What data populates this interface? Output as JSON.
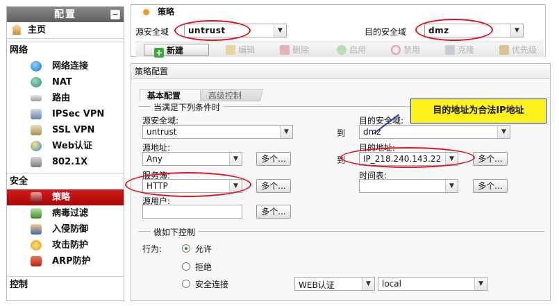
{
  "sidebar": {
    "title": "配置",
    "collapse_label": "−",
    "home": "主页",
    "sections": {
      "network": "网络",
      "security": "安全",
      "control": "控制"
    },
    "network_items": [
      "网络连接",
      "NAT",
      "路由",
      "IPSec VPN",
      "SSL VPN",
      "Web认证",
      "802.1X"
    ],
    "security_items": [
      "策略",
      "病毒过滤",
      "入侵防御",
      "攻击防护",
      "ARP防护"
    ],
    "active_item": "策略"
  },
  "policy_panel": {
    "title": "策略",
    "src_zone_label": "源安全域",
    "src_zone_value": "untrust",
    "dst_zone_label": "目的安全域",
    "dst_zone_value": "dmz",
    "toolbar": {
      "new": "新建",
      "edit": "编辑",
      "delete": "删除",
      "enable": "启用",
      "disable": "禁用",
      "clone": "克隆",
      "priority": "优先级"
    }
  },
  "dialog": {
    "title": "策略配置",
    "tab_basic": "基本配置",
    "tab_advanced": "高级控制",
    "group_conditions": "当满足下列条件时",
    "src_zone_label": "源安全域:",
    "src_zone_value": "untrust",
    "to_label": "到",
    "dst_zone_label": "目的安全域:",
    "dst_zone_value": "dmz",
    "src_addr_label": "源地址:",
    "src_addr_value": "Any",
    "more_label": "多个...",
    "dst_addr_label": "目的地址:",
    "dst_addr_value": "IP_218.240.143.22",
    "service_label": "服务簿:",
    "service_value": "HTTP",
    "schedule_label": "时间表:",
    "schedule_value": "",
    "src_user_label": "源用户:",
    "src_user_value": "",
    "group_action": "做如下控制",
    "action_label": "行为:",
    "action_permit": "允许",
    "action_deny": "拒绝",
    "action_secure": "安全连接",
    "auth_value": "WEB认证",
    "local_value": "local",
    "selected_action": "允许"
  },
  "annotation": {
    "callout_text": "目的地址为合法IP地址",
    "ring_color": "#e3111a",
    "callout_bg": "#fff21c"
  }
}
